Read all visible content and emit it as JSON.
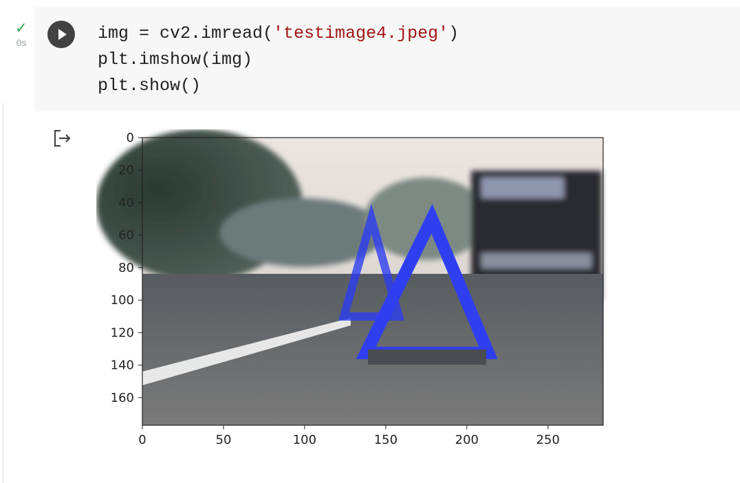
{
  "cell": {
    "status_icon": "check-icon",
    "status_check": "✓",
    "exec_time": "0s",
    "run_icon": "play-icon",
    "code": {
      "line1_a": "img = cv2.imread(",
      "line1_str": "'testimage4.jpeg'",
      "line1_b": ")",
      "line2": "plt.imshow(img)",
      "line3": "plt.show()"
    }
  },
  "output": {
    "icon": "output-redirect-icon"
  },
  "chart_data": {
    "type": "image",
    "title": "",
    "xlabel": "",
    "ylabel": "",
    "xlim": [
      0,
      284
    ],
    "ylim": [
      177,
      0
    ],
    "x_ticks": [
      0,
      50,
      100,
      150,
      200,
      250
    ],
    "y_ticks": [
      0,
      20,
      40,
      60,
      80,
      100,
      120,
      140,
      160
    ],
    "image_description_colors": {
      "triangle": "#2f3ff0",
      "road": "#6a6a6a",
      "sky": "#e6e0dc",
      "line": "#f2f2f2"
    }
  }
}
